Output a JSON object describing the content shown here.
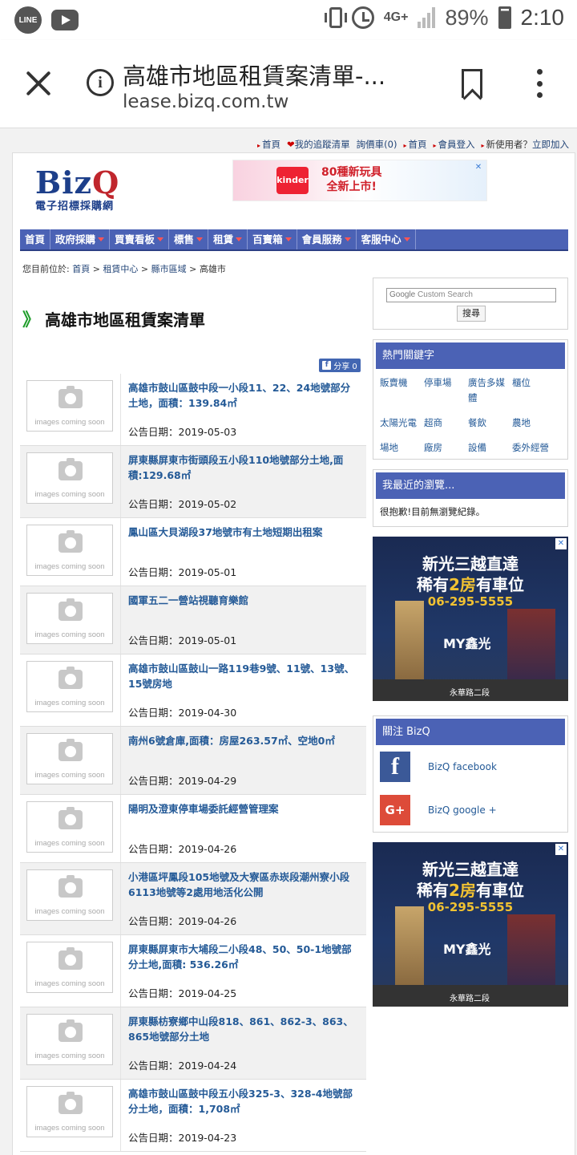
{
  "status_bar": {
    "battery": "89%",
    "time": "2:10",
    "network": "4G+"
  },
  "browser": {
    "title": "高雄市地區租賃案清單-...",
    "url": "lease.bizq.com.tw"
  },
  "top_links": [
    "首頁",
    "我的追蹤清單",
    "詢價車(0)",
    "首頁",
    "會員登入"
  ],
  "new_user_label": "新使用者？",
  "signup_link": "立即加入",
  "logo": {
    "main": "BizQ",
    "sub": "電子招標採購網"
  },
  "ad_banner": {
    "line1": "80種新玩具",
    "line2": "全新上市!",
    "brand": "kinder"
  },
  "nav": [
    "首頁",
    "政府採購",
    "買賣看板",
    "標售",
    "租賃",
    "百寶箱",
    "會員服務",
    "客服中心"
  ],
  "breadcrumb": {
    "prefix": "您目前位於:",
    "items": [
      "首頁",
      "租賃中心",
      "縣市區域",
      "高雄市"
    ]
  },
  "page_title": "高雄市地區租賃案清單",
  "share_label": "分享 0",
  "thumb_placeholder": "images coming soon",
  "listings": [
    {
      "title": "高雄市鼓山區鼓中段一小段11、22、24地號部分土地，面積：139.84㎡",
      "date": "公告日期：2019-05-03"
    },
    {
      "title": "屏東縣屏東市街頭段五小段110地號部分土地,面積:129.68㎡",
      "date": "公告日期：2019-05-02"
    },
    {
      "title": "鳳山區大貝湖段37地號市有土地短期出租案",
      "date": "公告日期：2019-05-01"
    },
    {
      "title": "國軍五二一營站視聽育樂館",
      "date": "公告日期：2019-05-01"
    },
    {
      "title": "高雄市鼓山區鼓山一路119巷9號、11號、13號、15號房地",
      "date": "公告日期：2019-04-30"
    },
    {
      "title": "南州6號倉庫,面積：房屋263.57㎡、空地0㎡",
      "date": "公告日期：2019-04-29"
    },
    {
      "title": "陽明及澄東停車場委託經營管理案",
      "date": "公告日期：2019-04-26"
    },
    {
      "title": "小港區坪鳳段105地號及大寮區赤崁段潮州寮小段6113地號等2處用地活化公開",
      "date": "公告日期：2019-04-26"
    },
    {
      "title": "屏東縣屏東市大埔段二小段48、50、50-1地號部分土地,面積: 536.26㎡",
      "date": "公告日期：2019-04-25"
    },
    {
      "title": "屏東縣枋寮鄉中山段818、861、862-3、863、865地號部分土地",
      "date": "公告日期：2019-04-24"
    },
    {
      "title": "高雄市鼓山區鼓中段五小段325-3、328-4地號部分土地，面積：1,708㎡",
      "date": "公告日期：2019-04-23"
    }
  ],
  "sidebar": {
    "search_placeholder": "Custom Search",
    "search_google": "Google",
    "search_button": "搜尋",
    "hot_keywords_title": "熱門關鍵字",
    "hot_keywords": [
      "販賣機",
      "停車場",
      "廣告多媒體",
      "櫃位",
      "太陽光電",
      "超商",
      "餐飲",
      "農地",
      "場地",
      "廠房",
      "設備",
      "委外經營"
    ],
    "recent_title": "我最近的瀏覽...",
    "recent_empty": "很抱歉!目前無瀏覽紀錄。",
    "ad": {
      "line1": "新光三越直達",
      "line2a": "稀有",
      "line2b": "2房",
      "line2c": "有車位",
      "phone": "06-295-5555",
      "brand": "MY鑫光",
      "road": "永華路二段"
    },
    "follow_title": "關注 BizQ",
    "facebook_label": "BizQ facebook",
    "google_label": "BizQ google +"
  }
}
